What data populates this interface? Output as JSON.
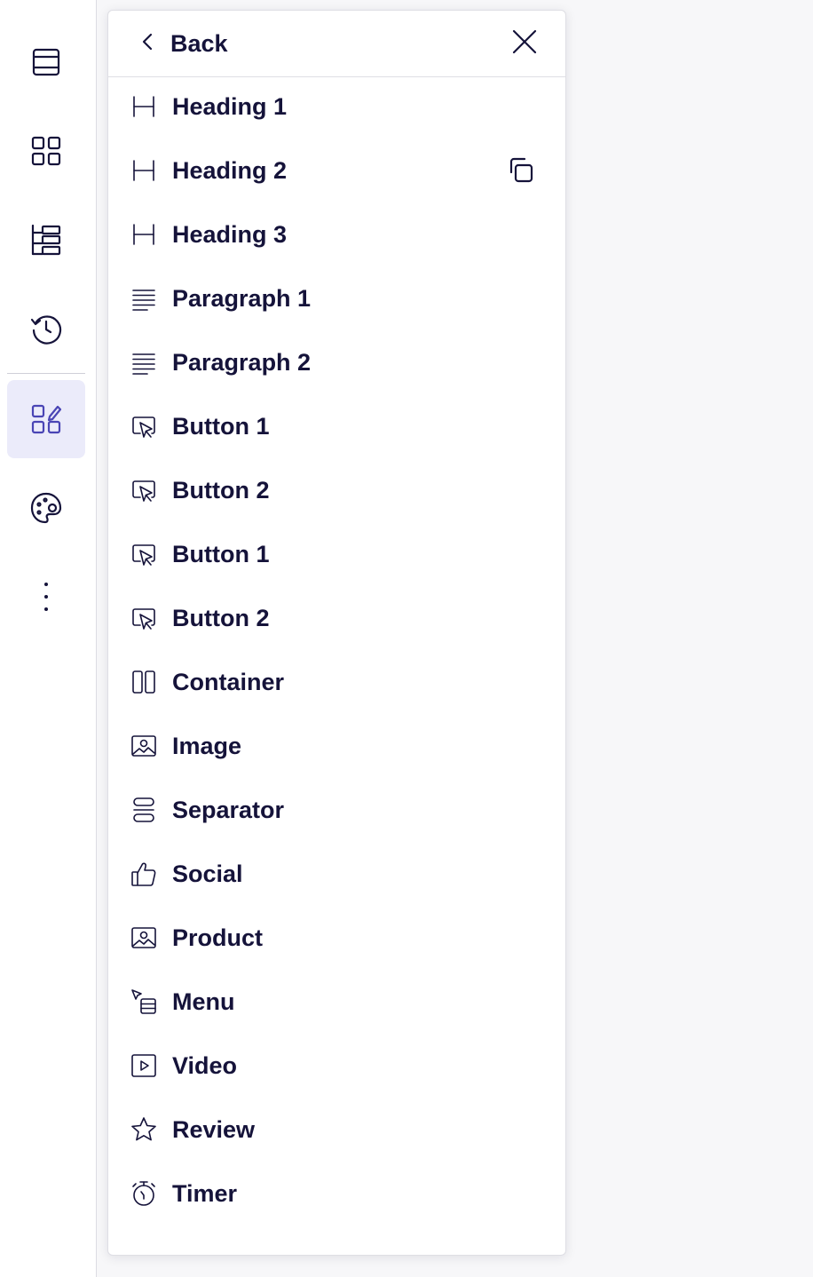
{
  "sidebar": {
    "items": [
      {
        "icon": "layout-rows-icon"
      },
      {
        "icon": "grid-icon"
      },
      {
        "icon": "tree-structure-icon"
      },
      {
        "icon": "history-icon"
      },
      {
        "icon": "widgets-edit-icon",
        "active": true
      },
      {
        "icon": "palette-icon"
      },
      {
        "icon": "more-vertical-icon"
      }
    ],
    "active_color": "#ebebfa"
  },
  "panel": {
    "back_label": "Back",
    "back_icon": "chevron-left-icon",
    "close_icon": "close-icon",
    "duplicate_icon": "copy-icon",
    "items": [
      {
        "label": "Heading 1",
        "icon": "heading-icon"
      },
      {
        "label": "Heading 2",
        "icon": "heading-icon"
      },
      {
        "label": "Heading 3",
        "icon": "heading-icon"
      },
      {
        "label": "Paragraph 1",
        "icon": "paragraph-icon"
      },
      {
        "label": "Paragraph 2",
        "icon": "paragraph-icon"
      },
      {
        "label": "Button 1",
        "icon": "button-cursor-icon"
      },
      {
        "label": "Button 2",
        "icon": "button-cursor-icon"
      },
      {
        "label": "Button 1",
        "icon": "button-cursor-icon"
      },
      {
        "label": "Button 2",
        "icon": "button-cursor-icon"
      },
      {
        "label": "Container",
        "icon": "columns-icon"
      },
      {
        "label": "Image",
        "icon": "image-icon"
      },
      {
        "label": "Separator",
        "icon": "separator-icon"
      },
      {
        "label": "Social",
        "icon": "thumbs-up-icon"
      },
      {
        "label": "Product",
        "icon": "image-icon"
      },
      {
        "label": "Menu",
        "icon": "menu-cursor-icon"
      },
      {
        "label": "Video",
        "icon": "video-play-icon"
      },
      {
        "label": "Review",
        "icon": "star-icon"
      },
      {
        "label": "Timer",
        "icon": "stopwatch-icon"
      }
    ]
  },
  "colors": {
    "text": "#15133a",
    "accent": "#4a45b5",
    "background": "#f7f7f9"
  }
}
